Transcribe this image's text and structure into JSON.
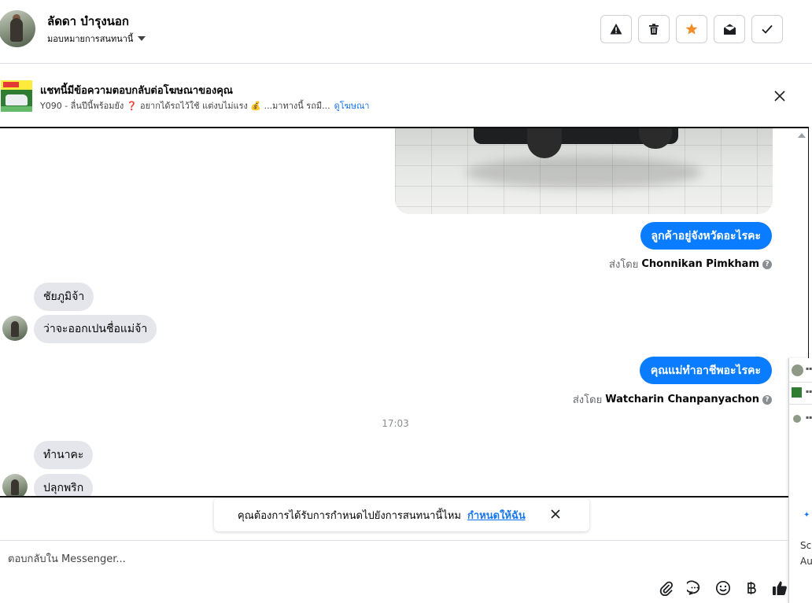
{
  "header": {
    "contact_name": "ลัดดา บำรุงนอก",
    "assign_label": "มอบหมายการสนทนานี้"
  },
  "ad": {
    "title": "แชทนี้มีข้อความตอบกลับต่อโฆษณาของคุณ",
    "description": "Y090 - ลื่นปีนี้พร้อมยัง ❓ อยากได้รถไว้ใช้ แต่งบไม่แรง 💰 ...มาทางนี้ รถมื...",
    "link": "ดูโฆษณา"
  },
  "messages": [
    {
      "type": "outgoing",
      "text": "ลูกค้าอยู่จังหวัดอะไรคะ",
      "sent_by_label": "ส่งโดย",
      "sender": "Chonnikan Pimkham"
    },
    {
      "type": "incoming",
      "text": "ชัยภูมิจ้า"
    },
    {
      "type": "incoming",
      "text": "ว่าจะออกเปนชื่อแม่จ้า"
    },
    {
      "type": "outgoing",
      "text": "คุณแม่ทำอาชีพอะไรคะ",
      "sent_by_label": "ส่งโดย",
      "sender": "Watcharin Chanpanyachon"
    },
    {
      "type": "timestamp",
      "text": "17:03"
    },
    {
      "type": "incoming",
      "text": "ทำนาคะ"
    },
    {
      "type": "incoming",
      "text": "ปลุกพริก"
    }
  ],
  "notice": {
    "text": "คุณต้องการได้รับการกำหนดไปยังการสนทนานี้ไหม",
    "link": "กำหนดให้ฉัน"
  },
  "composer": {
    "placeholder": "ตอบกลับใน Messenger..."
  },
  "side_panel": {
    "line1": "Sc",
    "line2": "Au"
  },
  "colors": {
    "outgoing_bubble": "#0a7cff",
    "incoming_bubble": "#e4e6eb",
    "link": "#1877f2",
    "star": "#f28c28"
  }
}
